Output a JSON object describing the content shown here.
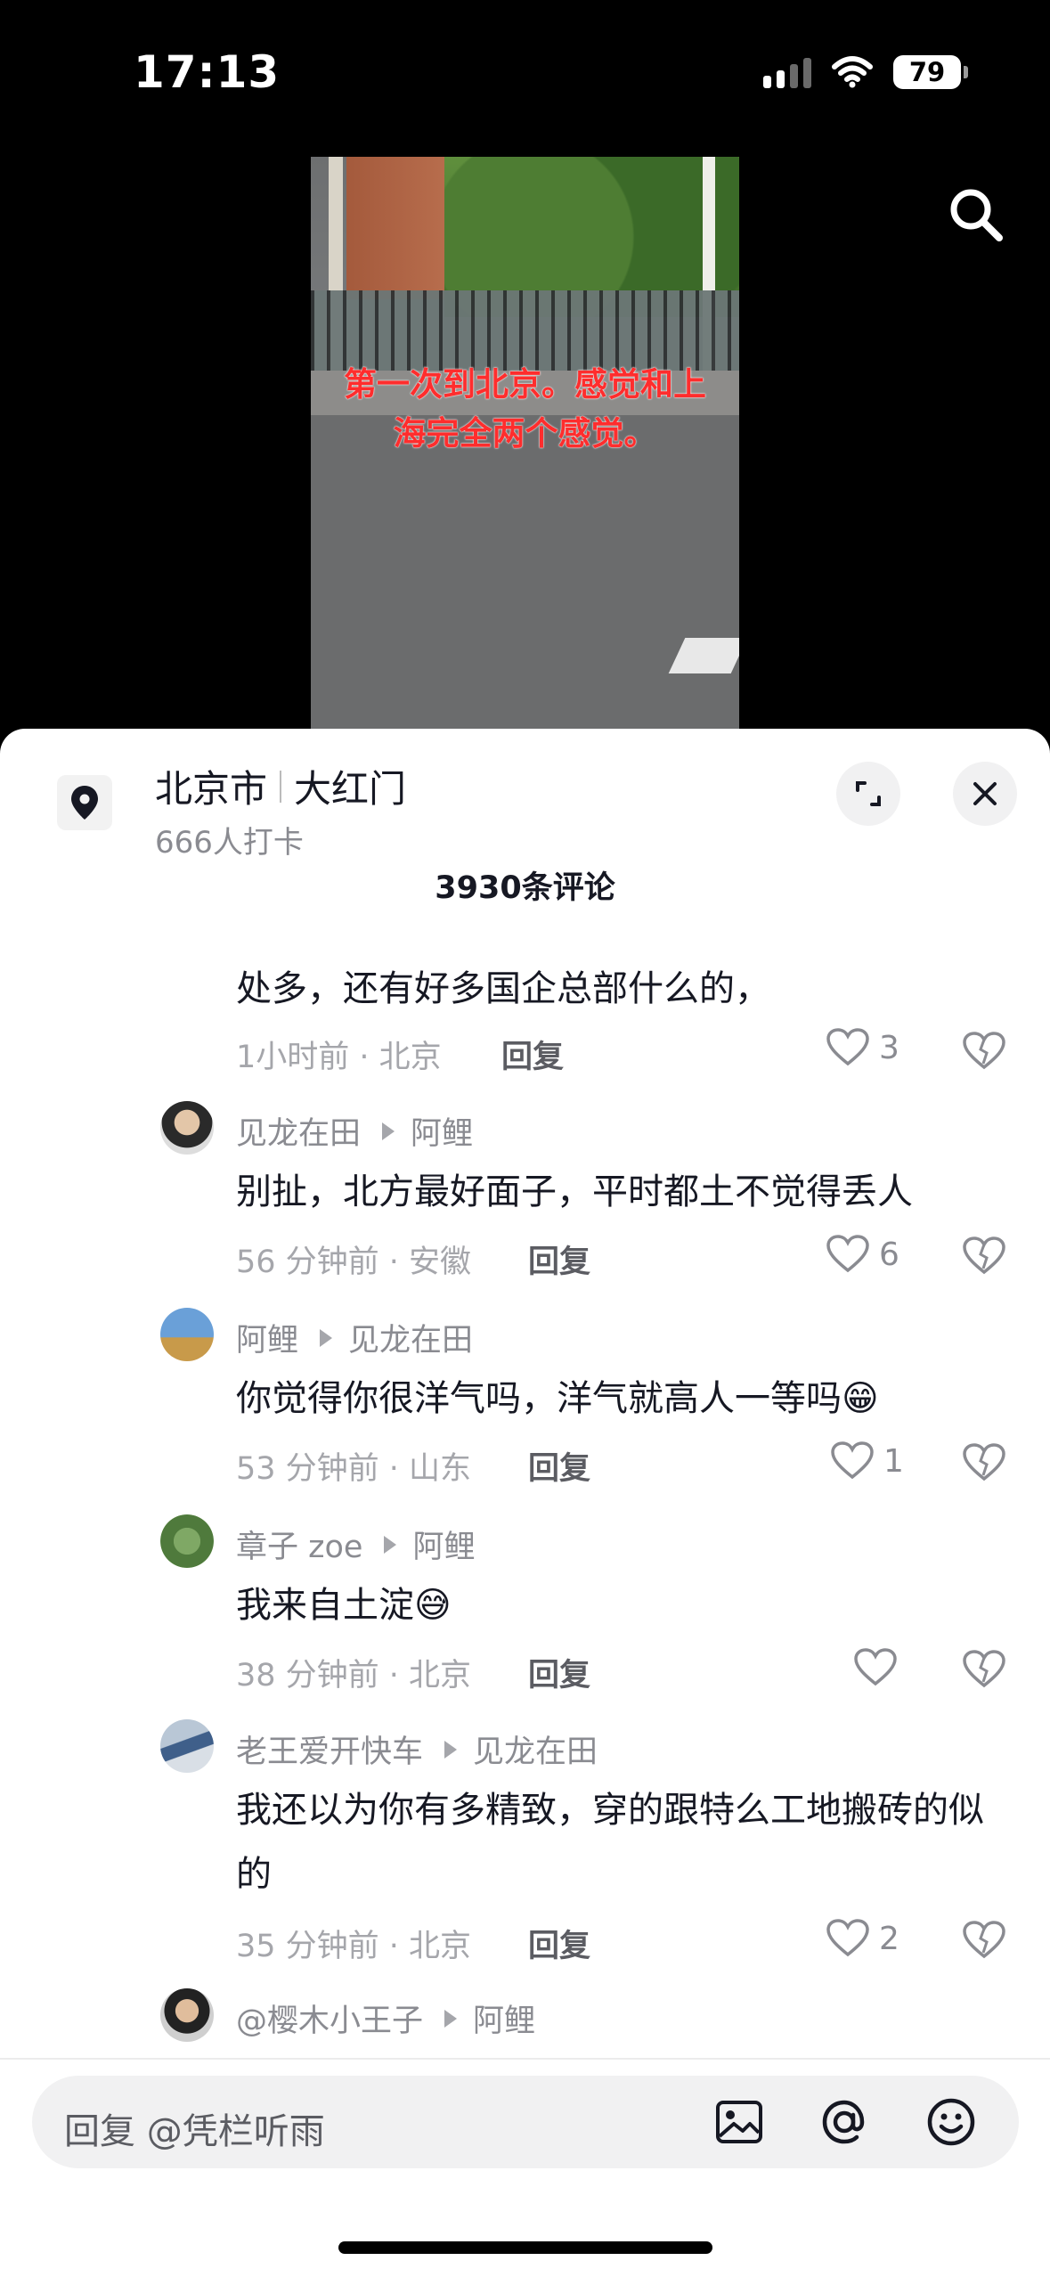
{
  "status_bar": {
    "time": "17:13",
    "battery": "79"
  },
  "video": {
    "caption": "第一次到北京。感觉和上海完全两个感觉。"
  },
  "location": {
    "city": "北京市",
    "place": "大红门",
    "checkins": "666人打卡"
  },
  "comments_header": {
    "count_label": "3930条评论"
  },
  "partial_comment": {
    "text": "处多，还有好多国企总部什么的，",
    "time_loc": "1小时前 · 北京",
    "reply_label": "回复",
    "likes": "3"
  },
  "comments": [
    {
      "author": "见龙在田",
      "reply_to": "阿鲤",
      "text": "别扯，北方最好面子，平时都土不觉得丢人",
      "time_loc": "56 分钟前 · 安徽",
      "reply_label": "回复",
      "likes": "6"
    },
    {
      "author": "阿鲤",
      "reply_to": "见龙在田",
      "text": "你觉得你很洋气吗，洋气就高人一等吗😁",
      "time_loc": "53 分钟前 · 山东",
      "reply_label": "回复",
      "likes": "1"
    },
    {
      "author": "章子 zoe",
      "reply_to": "阿鲤",
      "text": "我来自土淀😅",
      "time_loc": "38 分钟前 · 北京",
      "reply_label": "回复",
      "likes": ""
    },
    {
      "author": "老王爱开快车",
      "reply_to": "见龙在田",
      "text": "我还以为你有多精致，穿的跟特么工地搬砖的似的",
      "time_loc": "35 分钟前 · 北京",
      "reply_label": "回复",
      "likes": "2"
    },
    {
      "author": "@樱木小王子",
      "reply_to": "阿鲤"
    }
  ],
  "input": {
    "placeholder": "回复 @凭栏听雨"
  },
  "icons": [
    "location-pin-icon",
    "search-icon",
    "expand-icon",
    "close-icon",
    "heart-icon",
    "broken-heart-icon",
    "image-icon",
    "at-icon",
    "emoji-icon"
  ],
  "colors": {
    "caption_red": "#ff2d2d",
    "text_dark": "#161823",
    "text_gray": "#8a8b91"
  }
}
